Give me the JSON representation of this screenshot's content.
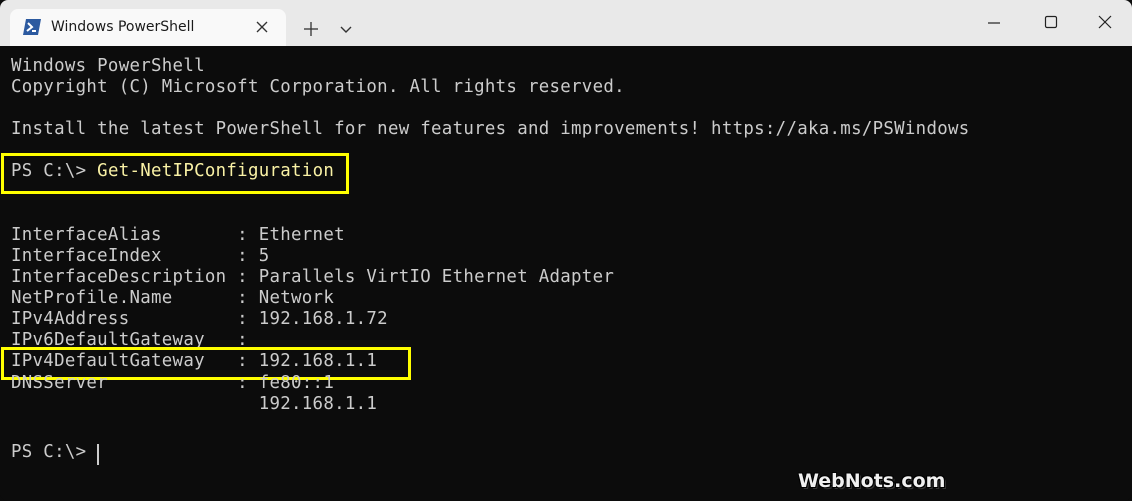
{
  "window": {
    "tab_title": "Windows PowerShell",
    "tab_icon": "powershell-icon",
    "buttons": [
      "new-tab-icon",
      "chevron-down-icon",
      "minimize-icon",
      "maximize-icon",
      "close-icon"
    ]
  },
  "terminal": {
    "header1": "Windows PowerShell",
    "header2": "Copyright (C) Microsoft Corporation. All rights reserved.",
    "header3": "Install the latest PowerShell for new features and improvements! https://aka.ms/PSWindows",
    "prompt": "PS C:\\>",
    "command": "Get-NetIPConfiguration",
    "output": {
      "alias": "InterfaceAlias       : Ethernet",
      "index": "InterfaceIndex       : 5",
      "description": "InterfaceDescription : Parallels VirtIO Ethernet Adapter",
      "profile": "NetProfile.Name      : Network",
      "ipv4": "IPv4Address          : 192.168.1.72",
      "ipv6gw": "IPv6DefaultGateway   :",
      "ipv4gw": "IPv4DefaultGateway   : 192.168.1.1",
      "dns1": "DNSServer            : fe80::1",
      "dns2": "                       192.168.1.1"
    },
    "final_prompt": "PS C:\\>"
  },
  "watermark": "WebNots.com",
  "colors": {
    "highlight": "#ffff00",
    "command": "#f9f1a5",
    "text": "#cccccc",
    "background": "#0c0c0c"
  }
}
